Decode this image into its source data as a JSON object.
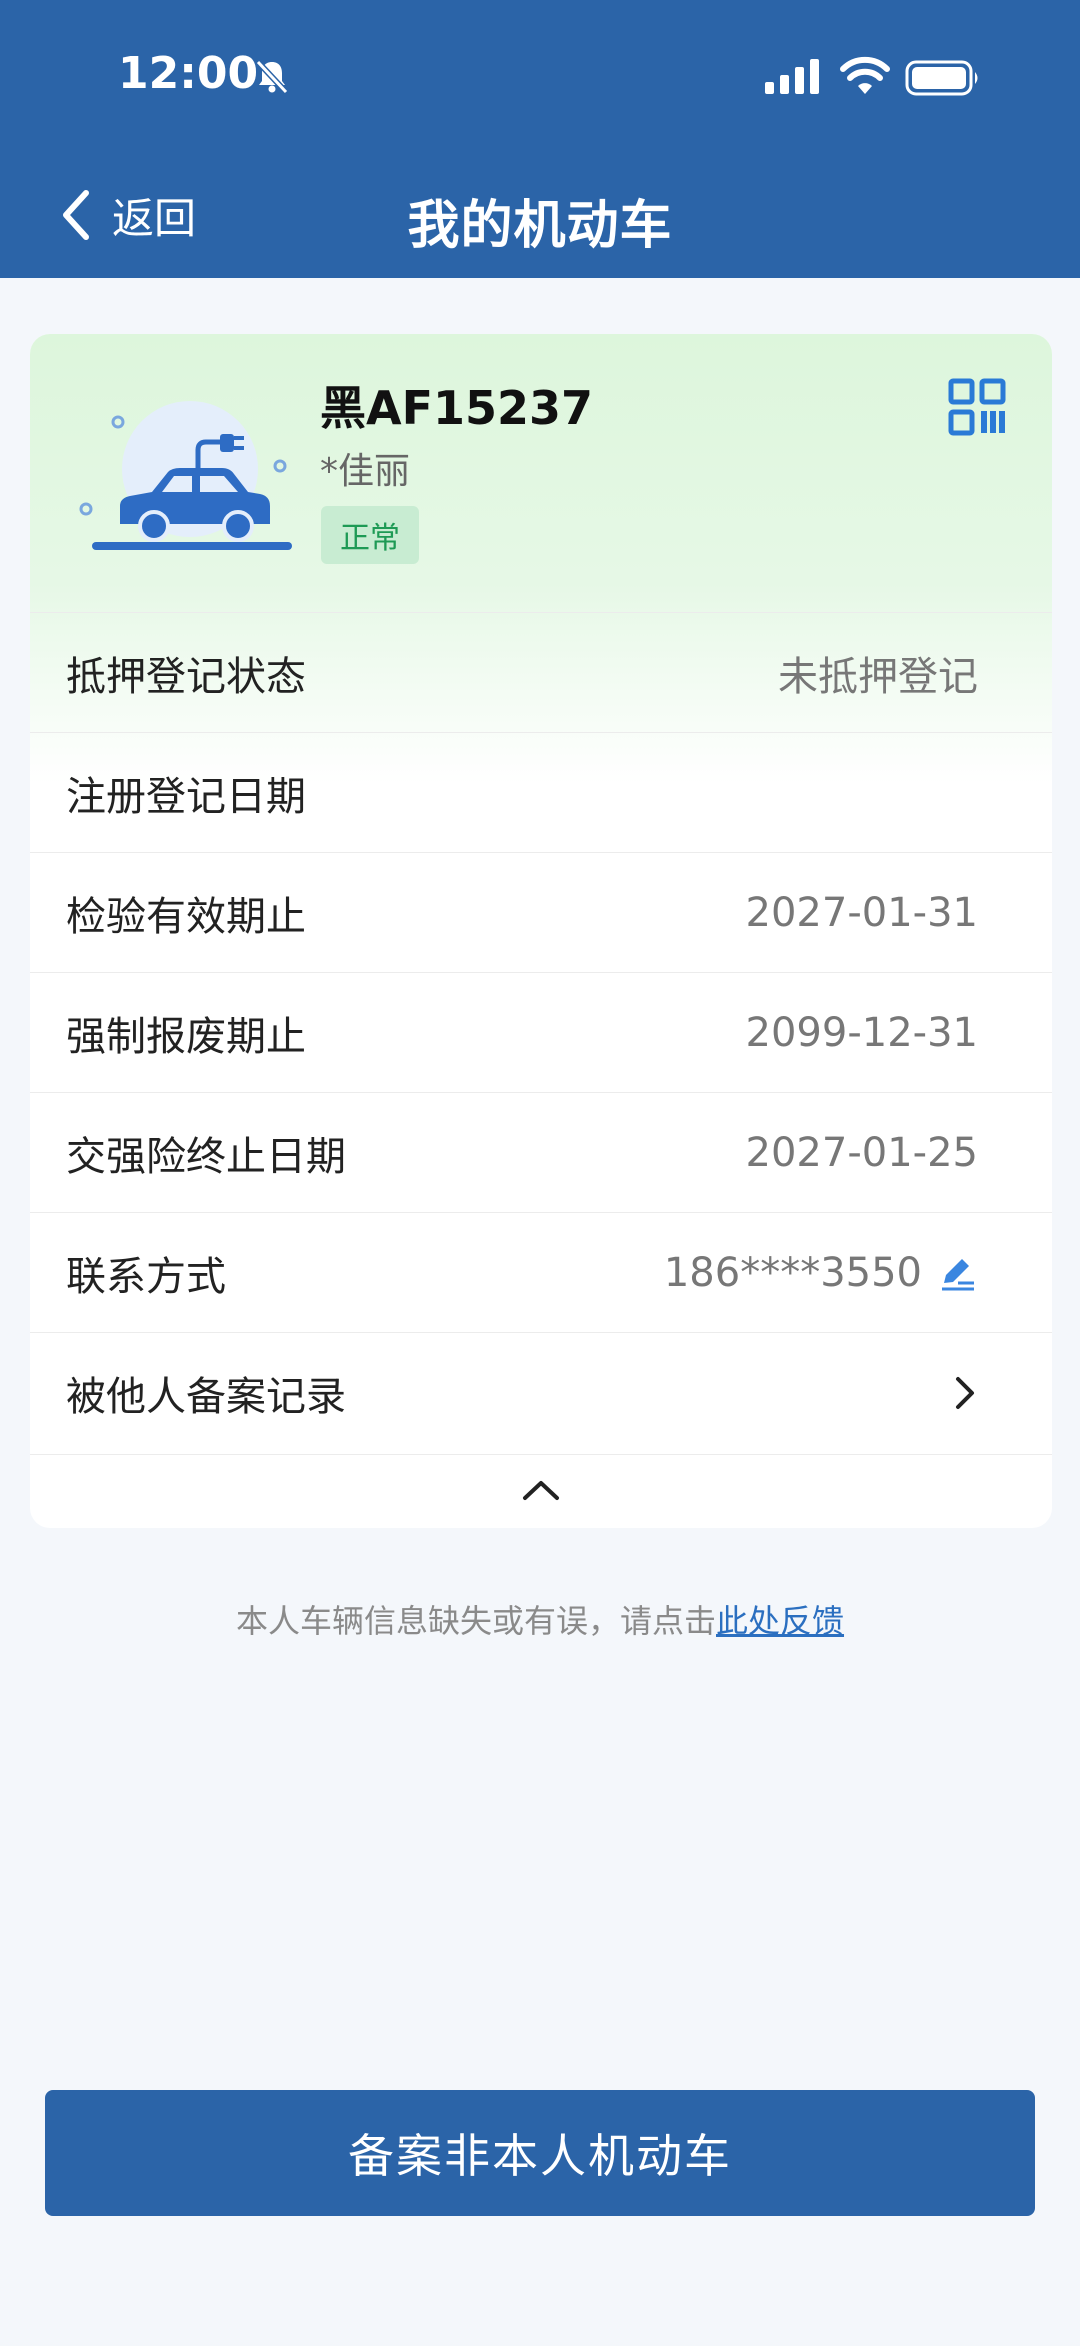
{
  "status_bar": {
    "time": "12:00"
  },
  "header": {
    "back_label": "返回",
    "title": "我的机动车"
  },
  "vehicle": {
    "plate": "黑AF15237",
    "owner": "*佳丽",
    "status": "正常"
  },
  "details": [
    {
      "label": "抵押登记状态",
      "value": "未抵押登记"
    },
    {
      "label": "注册登记日期",
      "value": ""
    },
    {
      "label": "检验有效期止",
      "value": "2027-01-31"
    },
    {
      "label": "强制报废期止",
      "value": "2099-12-31"
    },
    {
      "label": "交强险终止日期",
      "value": "2027-01-25"
    },
    {
      "label": "联系方式",
      "value": "186****3550"
    },
    {
      "label": "被他人备案记录",
      "value": ""
    }
  ],
  "feedback": {
    "text": "本人车辆信息缺失或有误，请点击",
    "link": "此处反馈"
  },
  "bottom_button": {
    "label": "备案非本人机动车"
  },
  "colors": {
    "primary": "#2b64a8",
    "status_green": "#1e9a55",
    "link": "#2b6fc0"
  }
}
